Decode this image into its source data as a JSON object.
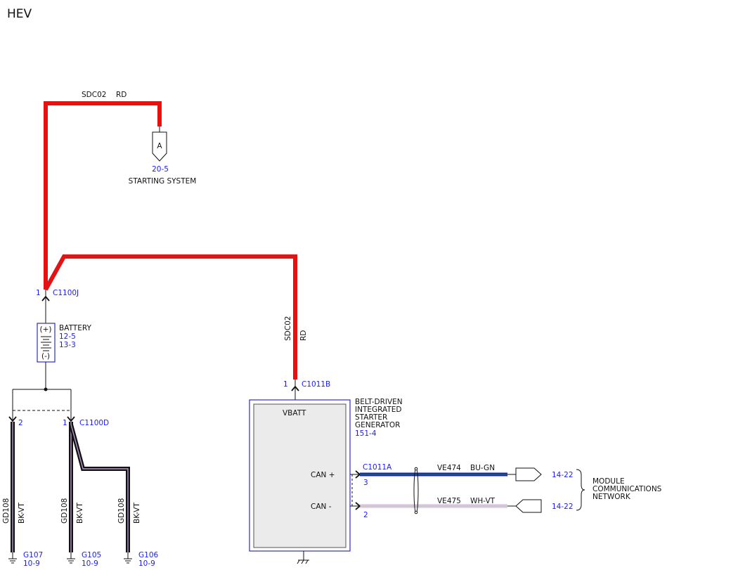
{
  "page": {
    "title": "HEV"
  },
  "colors": {
    "red_wire": "#e41212",
    "blue_wire": "#1428a8",
    "black_wire": "#111111",
    "bkvt_stripe": "#b497c8",
    "whvt_stripe": "#c8a0d2",
    "link_ref": "#1a1aff",
    "component_outline": "#2b2bd0",
    "component_fill": "#ebebeb"
  },
  "wires": {
    "top_red": {
      "circuit": "SDC02",
      "color": "RD"
    },
    "gen_feed": {
      "circuit": "SDC02",
      "color": "RD"
    },
    "can_plus": {
      "circuit": "VE474",
      "color": "BU-GN"
    },
    "can_minus": {
      "circuit": "VE475",
      "color": "WH-VT"
    },
    "ground_1": {
      "circuit": "GD108",
      "color": "BK-VT"
    },
    "ground_2": {
      "circuit": "GD108",
      "color": "BK-VT"
    },
    "ground_3": {
      "circuit": "GD108",
      "color": "BK-VT"
    }
  },
  "connectors": {
    "starting_ref": {
      "letter": "A",
      "page": "20-5",
      "label": "STARTING SYSTEM"
    },
    "c1100j": {
      "pin": "1",
      "name": "C1100J"
    },
    "c1011b": {
      "pin": "1",
      "name": "C1011B"
    },
    "c1100d": {
      "pin_left": "2",
      "pin_right": "1",
      "name": "C1100D"
    },
    "c1011a": {
      "name": "C1011A",
      "pin_plus": "3",
      "pin_minus": "2"
    }
  },
  "battery": {
    "name": "BATTERY",
    "ref1": "12-5",
    "ref2": "13-3",
    "plus": "(+)",
    "minus": "(-)"
  },
  "generator": {
    "line1": "BELT-DRIVEN",
    "line2": "INTEGRATED",
    "line3": "STARTER",
    "line4": "GENERATOR",
    "ref": "151-4",
    "vbatt": "VBATT",
    "can_plus": "CAN +",
    "can_minus": "CAN -"
  },
  "grounds": [
    {
      "name": "G107",
      "ref": "10-9"
    },
    {
      "name": "G105",
      "ref": "10-9"
    },
    {
      "name": "G106",
      "ref": "10-9"
    }
  ],
  "network": {
    "ref_plus": "14-22",
    "ref_minus": "14-22",
    "line1": "MODULE",
    "line2": "COMMUNICATIONS",
    "line3": "NETWORK"
  }
}
